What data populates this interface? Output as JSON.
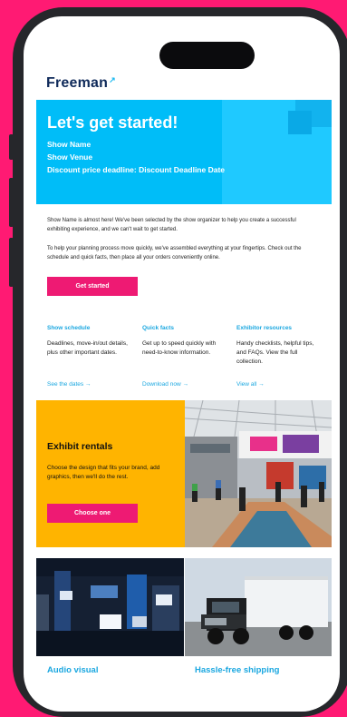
{
  "brand": {
    "name": "Freeman",
    "mark": "↗"
  },
  "hero": {
    "title": "Let's get started!",
    "lines": [
      "Show Name",
      "Show Venue",
      "Discount price deadline: Discount Deadline Date"
    ]
  },
  "intro": {
    "p1": "Show Name is almost here! We've been selected by the show organizer to help you create a successful exhibiting experience, and we can't wait to get started.",
    "p2": "To help your planning process move quickly, we've assembled everything at your fingertips. Check out the schedule and quick facts, then place all your orders conveniently online."
  },
  "cta": {
    "label": "Get started"
  },
  "columns": [
    {
      "heading": "Show schedule",
      "body": "Deadlines, move-in/out details, plus other important dates.",
      "link": "See the dates →"
    },
    {
      "heading": "Quick facts",
      "body": "Get up to speed quickly with need-to-know information.",
      "link": "Download now →"
    },
    {
      "heading": "Exhibitor resources",
      "body": "Handy checklists, helpful tips, and FAQs. View the full collection.",
      "link": "View all →"
    }
  ],
  "rentals": {
    "title": "Exhibit rentals",
    "body": "Choose the design that fits your brand, add graphics, then we'll do the rest.",
    "button": "Choose one"
  },
  "footer_tiles": {
    "left": "Audio visual",
    "right": "Hassle-free shipping"
  },
  "colors": {
    "accent_pink": "#ee1a73",
    "hero_blue": "#00bdf8",
    "link_blue": "#1aa7e0",
    "rental_yellow": "#ffb400",
    "navy": "#0f2a5a"
  }
}
